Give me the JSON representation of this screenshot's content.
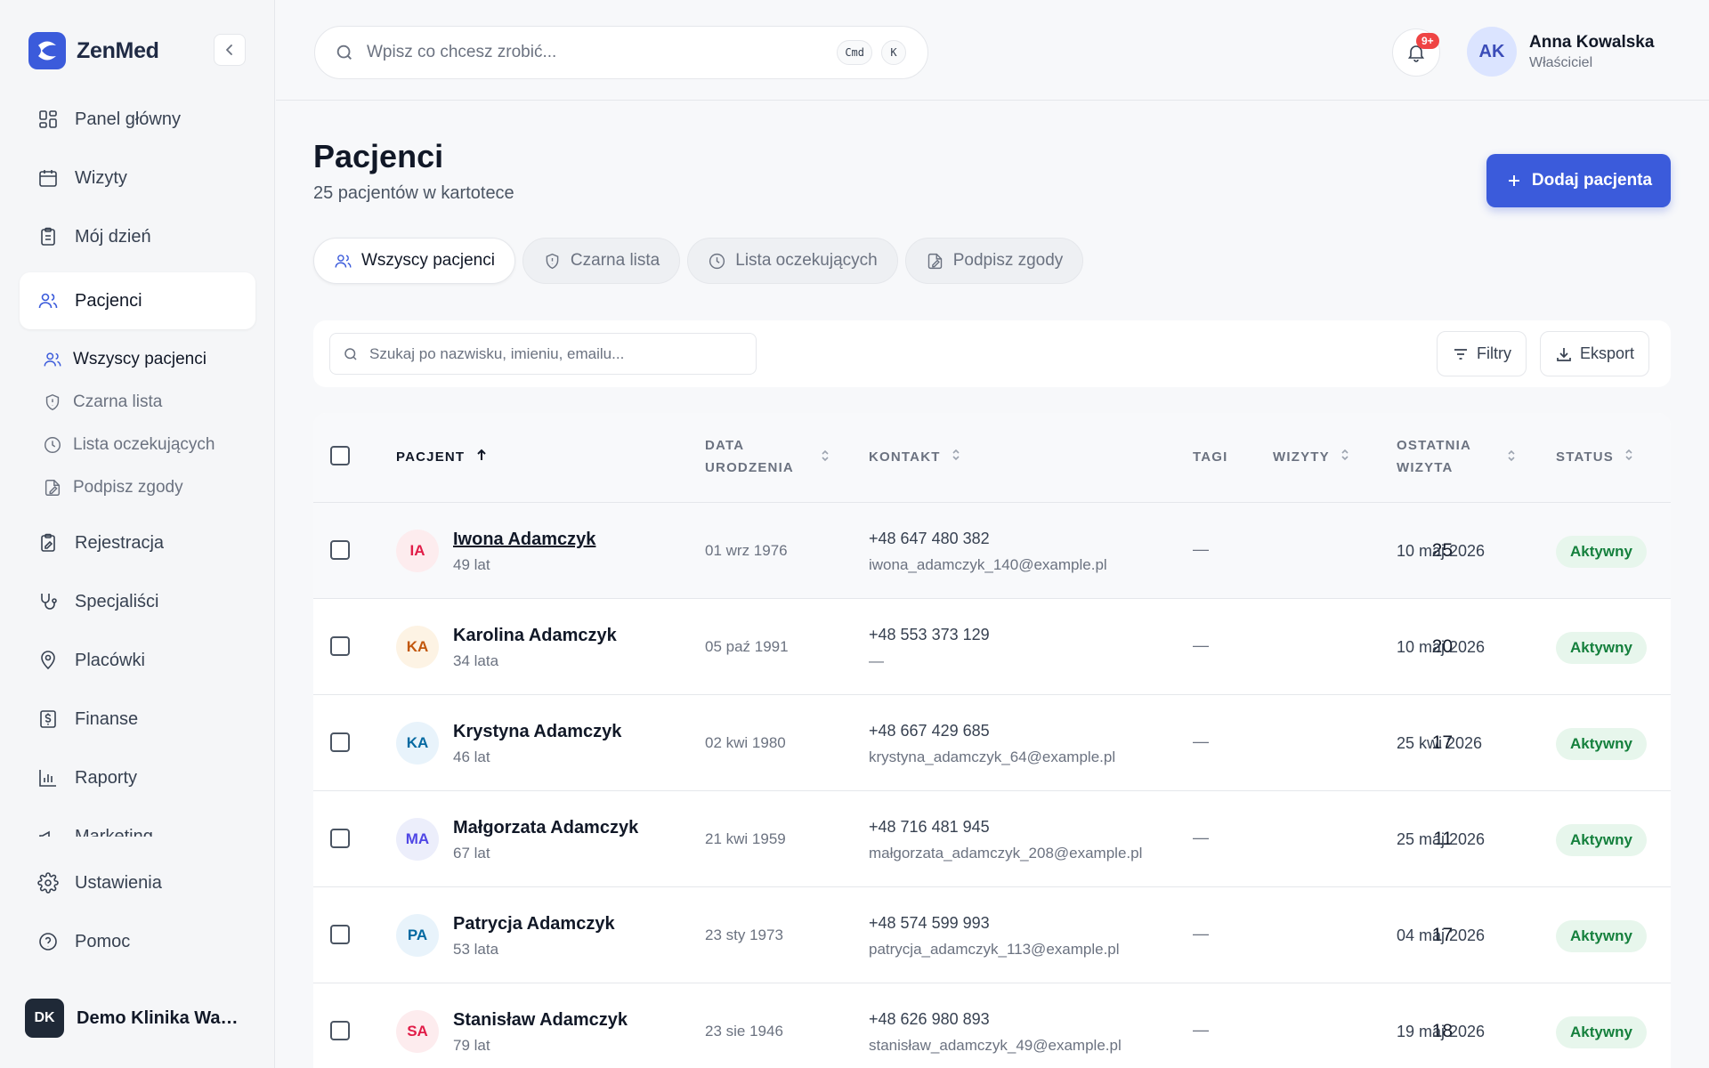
{
  "brand": {
    "name": "ZenMed",
    "color": "#3b5bdb"
  },
  "sidebar": {
    "items": [
      {
        "label": "Panel główny",
        "icon": "dashboard-icon"
      },
      {
        "label": "Wizyty",
        "icon": "calendar-icon"
      },
      {
        "label": "Mój dzień",
        "icon": "clipboard-icon"
      },
      {
        "label": "Pacjenci",
        "icon": "users-icon",
        "active": true
      }
    ],
    "sub_items": [
      {
        "label": "Wszyscy pacjenci",
        "icon": "users-icon",
        "active": true
      },
      {
        "label": "Czarna lista",
        "icon": "shield-icon"
      },
      {
        "label": "Lista oczekujących",
        "icon": "clock-icon"
      },
      {
        "label": "Podpisz zgody",
        "icon": "sign-doc-icon"
      }
    ],
    "items_after": [
      {
        "label": "Rejestracja",
        "icon": "clipboard-edit-icon"
      },
      {
        "label": "Specjaliści",
        "icon": "stethoscope-icon"
      },
      {
        "label": "Placówki",
        "icon": "map-pin-icon"
      },
      {
        "label": "Finanse",
        "icon": "dollar-receipt-icon"
      },
      {
        "label": "Raporty",
        "icon": "bar-chart-icon"
      },
      {
        "label": "Marketing",
        "icon": "megaphone-icon"
      }
    ],
    "bottom_items": [
      {
        "label": "Ustawienia",
        "icon": "gear-icon"
      },
      {
        "label": "Pomoc",
        "icon": "help-icon"
      }
    ],
    "org": {
      "initials": "DK",
      "name": "Demo Klinika Warszawa"
    }
  },
  "topbar": {
    "search_placeholder": "Wpisz co chcesz zrobić...",
    "shortcut_cmd": "Cmd",
    "shortcut_key": "K",
    "notifications_badge": "9+",
    "user": {
      "initials": "AK",
      "name": "Anna Kowalska",
      "role": "Właściciel"
    }
  },
  "page": {
    "title": "Pacjenci",
    "subtitle": "25 pacjentów w kartotece",
    "add_button": "Dodaj pacjenta"
  },
  "tabs": [
    {
      "label": "Wszyscy pacjenci",
      "icon": "users-icon",
      "active": true
    },
    {
      "label": "Czarna lista",
      "icon": "shield-icon"
    },
    {
      "label": "Lista oczekujących",
      "icon": "clock-icon"
    },
    {
      "label": "Podpisz zgody",
      "icon": "sign-doc-icon"
    }
  ],
  "filters": {
    "search_placeholder": "Szukaj po nazwisku, imieniu, emailu...",
    "filters_button": "Filtry",
    "export_button": "Eksport"
  },
  "table": {
    "columns": {
      "patient": "PACJENT",
      "dob_1": "DATA",
      "dob_2": "URODZENIA",
      "contact": "KONTAKT",
      "tags": "TAGI",
      "visits": "WIZYTY",
      "last_1": "OSTATNIA",
      "last_2": "WIZYTA",
      "status": "STATUS"
    },
    "rows": [
      {
        "initials": "IA",
        "name": "Iwona Adamczyk",
        "age": "49 lat",
        "dob": "01 wrz 1976",
        "phone": "+48 647 480 382",
        "email": "iwona_adamczyk_140@example.pl",
        "tags": "—",
        "visits": "25",
        "last": "10 maj 2026",
        "status": "Aktywny",
        "avatar_bg": "#fdecee",
        "avatar_fg": "#e11d48"
      },
      {
        "initials": "KA",
        "name": "Karolina Adamczyk",
        "age": "34 lata",
        "dob": "05 paź 1991",
        "phone": "+48 553 373 129",
        "email": "—",
        "tags": "—",
        "visits": "20",
        "last": "10 maj 2026",
        "status": "Aktywny",
        "avatar_bg": "#fdf3e4",
        "avatar_fg": "#c2570c"
      },
      {
        "initials": "KA",
        "name": "Krystyna Adamczyk",
        "age": "46 lat",
        "dob": "02 kwi 1980",
        "phone": "+48 667 429 685",
        "email": "krystyna_adamczyk_64@example.pl",
        "tags": "—",
        "visits": "17",
        "last": "25 kwi 2026",
        "status": "Aktywny",
        "avatar_bg": "#e8f3fb",
        "avatar_fg": "#0369a1"
      },
      {
        "initials": "MA",
        "name": "Małgorzata Adamczyk",
        "age": "67 lat",
        "dob": "21 kwi 1959",
        "phone": "+48 716 481 945",
        "email": "małgorzata_adamczyk_208@example.pl",
        "tags": "—",
        "visits": "11",
        "last": "25 maj 2026",
        "status": "Aktywny",
        "avatar_bg": "#eceefb",
        "avatar_fg": "#4f46e5"
      },
      {
        "initials": "PA",
        "name": "Patrycja Adamczyk",
        "age": "53 lata",
        "dob": "23 sty 1973",
        "phone": "+48 574 599 993",
        "email": "patrycja_adamczyk_113@example.pl",
        "tags": "—",
        "visits": "17",
        "last": "04 maj 2026",
        "status": "Aktywny",
        "avatar_bg": "#e8f3fb",
        "avatar_fg": "#0369a1"
      },
      {
        "initials": "SA",
        "name": "Stanisław Adamczyk",
        "age": "79 lat",
        "dob": "23 sie 1946",
        "phone": "+48 626 980 893",
        "email": "stanisław_adamczyk_49@example.pl",
        "tags": "—",
        "visits": "18",
        "last": "19 maj 2026",
        "status": "Aktywny",
        "avatar_bg": "#fdecee",
        "avatar_fg": "#e11d48"
      }
    ]
  }
}
